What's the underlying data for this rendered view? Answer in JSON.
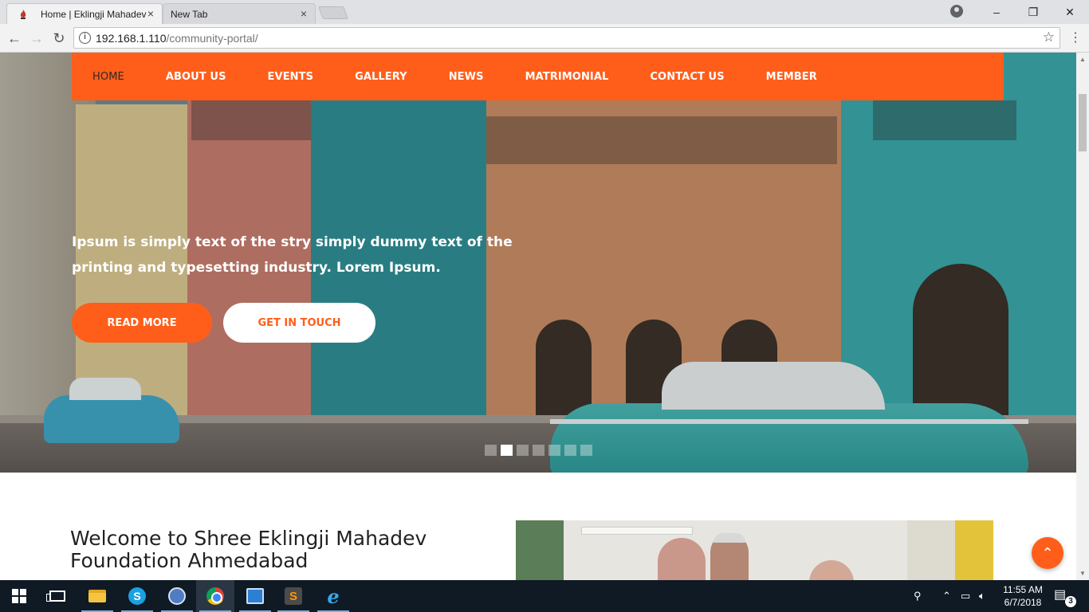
{
  "browser": {
    "tabs": [
      {
        "title": "Home | Eklingji Mahadev",
        "close": "×"
      },
      {
        "title": "New Tab",
        "close": "×"
      }
    ],
    "url_host": "192.168.1.110",
    "url_path": "/community-portal/",
    "window_controls": {
      "minimize": "–",
      "maximize": "❐",
      "close": "✕"
    },
    "nav": {
      "back": "←",
      "forward": "→",
      "reload": "↻",
      "info": "i",
      "bookmark": "☆",
      "menu": "⋮"
    }
  },
  "site": {
    "nav_items": [
      "HOME",
      "ABOUT US",
      "EVENTS",
      "GALLERY",
      "NEWS",
      "MATRIMONIAL",
      "CONTACT US",
      "MEMBER"
    ],
    "hero": {
      "text": "Ipsum is simply text of the stry simply dummy text of the printing and typesetting industry. Lorem Ipsum.",
      "read_more": "READ MORE",
      "get_in_touch": "GET IN TOUCH",
      "slide_count": 7,
      "active_slide": 2
    },
    "welcome_title": "Welcome to Shree Eklingji Mahadev Foundation Ahmedabad",
    "scroll_top_icon": "⌃",
    "accent_color": "#ff5e1a"
  },
  "taskbar": {
    "apps": [
      "start",
      "task-view",
      "file-explorer",
      "skype",
      "mail",
      "chrome",
      "teamviewer",
      "sublime-text",
      "internet-explorer"
    ],
    "time": "11:55 AM",
    "date": "6/7/2018",
    "notification_count": "3",
    "tray_icons": [
      "people-icon",
      "chevron-up-icon",
      "network-icon",
      "volume-icon"
    ]
  }
}
